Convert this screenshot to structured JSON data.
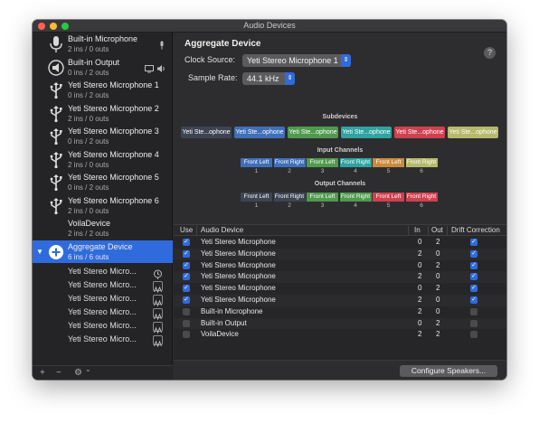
{
  "window": {
    "title": "Audio Devices"
  },
  "sidebar": {
    "devices": [
      {
        "name": "Built-in Microphone",
        "io": "2 ins / 0 outs",
        "icon": "microphone-icon"
      },
      {
        "name": "Built-in Output",
        "io": "0 ins / 2 outs",
        "icon": "speaker-icon"
      },
      {
        "name": "Yeti Stereo Microphone 1",
        "io": "0 ins / 2 outs",
        "icon": "usb-icon"
      },
      {
        "name": "Yeti Stereo Microphone 2",
        "io": "2 ins / 0 outs",
        "icon": "usb-icon"
      },
      {
        "name": "Yeti Stereo Microphone 3",
        "io": "0 ins / 2 outs",
        "icon": "usb-icon"
      },
      {
        "name": "Yeti Stereo Microphone 4",
        "io": "2 ins / 0 outs",
        "icon": "usb-icon"
      },
      {
        "name": "Yeti Stereo Microphone 5",
        "io": "0 ins / 2 outs",
        "icon": "usb-icon"
      },
      {
        "name": "Yeti Stereo Microphone 6",
        "io": "2 ins / 0 outs",
        "icon": "usb-icon"
      },
      {
        "name": "VoilaDevice",
        "io": "2 ins / 2 outs",
        "icon": ""
      },
      {
        "name": "Aggregate Device",
        "io": "6 ins / 6 outs",
        "icon": "plus-circle-icon"
      }
    ],
    "subdevices": [
      {
        "name": "Yeti Stereo Micro...",
        "icon": "microphone-clock-icon"
      },
      {
        "name": "Yeti Stereo Micro...",
        "icon": "waveform-icon"
      },
      {
        "name": "Yeti Stereo Micro...",
        "icon": "waveform-icon"
      },
      {
        "name": "Yeti Stereo Micro...",
        "icon": "waveform-icon"
      },
      {
        "name": "Yeti Stereo Micro...",
        "icon": "waveform-icon"
      },
      {
        "name": "Yeti Stereo Micro...",
        "icon": "waveform-icon"
      }
    ],
    "footer": {
      "add": "+",
      "remove": "−",
      "gear": "⚙",
      "chevron": "⌄"
    }
  },
  "main": {
    "title": "Aggregate Device",
    "clock_source_label": "Clock Source:",
    "clock_source_value": "Yeti Stereo Microphone 1",
    "sample_rate_label": "Sample Rate:",
    "sample_rate_value": "44.1 kHz",
    "help": "?",
    "subdevices_label": "Subdevices",
    "subdevice_chips": [
      {
        "label": "Yeti Ste...ophone",
        "color": "#3e4454"
      },
      {
        "label": "Yeti Ste...ophone",
        "color": "#3f6fb8"
      },
      {
        "label": "Yeti Ste...ophone",
        "color": "#4f9a4e"
      },
      {
        "label": "Yeti Ste...ophone",
        "color": "#2fa3a0"
      },
      {
        "label": "Yeti Ste...ophone",
        "color": "#d0404f"
      },
      {
        "label": "Yeti Ste...ophone",
        "color": "#b6b96a"
      }
    ],
    "input_channels_label": "Input Channels",
    "output_channels_label": "Output Channels",
    "channels": [
      {
        "label": "Front Left",
        "num": "1",
        "color": "#3f6fb8"
      },
      {
        "label": "Front Right",
        "num": "2",
        "color": "#3f6fb8"
      },
      {
        "label": "Front Left",
        "num": "3",
        "color": "#4f9a4e"
      },
      {
        "label": "Front Right",
        "num": "4",
        "color": "#2fa3a0"
      },
      {
        "label": "Front Left",
        "num": "5",
        "color": "#c88a3c"
      },
      {
        "label": "Front Right",
        "num": "6",
        "color": "#b6b96a"
      }
    ],
    "output_channels": [
      {
        "label": "Front Left",
        "num": "1",
        "color": "#3e4454"
      },
      {
        "label": "Front Right",
        "num": "2",
        "color": "#3e4454"
      },
      {
        "label": "Front Left",
        "num": "3",
        "color": "#4f9a4e"
      },
      {
        "label": "Front Right",
        "num": "4",
        "color": "#4f9a4e"
      },
      {
        "label": "Front Left",
        "num": "5",
        "color": "#d0404f"
      },
      {
        "label": "Front Right",
        "num": "6",
        "color": "#d0404f"
      }
    ],
    "table": {
      "headers": {
        "use": "Use",
        "device": "Audio Device",
        "in": "In",
        "out": "Out",
        "drift": "Drift Correction"
      },
      "rows": [
        {
          "use": true,
          "device": "Yeti Stereo Microphone",
          "in": "0",
          "out": "2",
          "drift": true
        },
        {
          "use": true,
          "device": "Yeti Stereo Microphone",
          "in": "2",
          "out": "0",
          "drift": true
        },
        {
          "use": true,
          "device": "Yeti Stereo Microphone",
          "in": "0",
          "out": "2",
          "drift": true
        },
        {
          "use": true,
          "device": "Yeti Stereo Microphone",
          "in": "2",
          "out": "0",
          "drift": true
        },
        {
          "use": true,
          "device": "Yeti Stereo Microphone",
          "in": "0",
          "out": "2",
          "drift": true
        },
        {
          "use": true,
          "device": "Yeti Stereo Microphone",
          "in": "2",
          "out": "0",
          "drift": true
        },
        {
          "use": false,
          "device": "Built-in Microphone",
          "in": "2",
          "out": "0",
          "drift": false
        },
        {
          "use": false,
          "device": "Built-in Output",
          "in": "0",
          "out": "2",
          "drift": false
        },
        {
          "use": false,
          "device": "VoilaDevice",
          "in": "2",
          "out": "2",
          "drift": false
        }
      ]
    },
    "configure_button": "Configure Speakers..."
  }
}
